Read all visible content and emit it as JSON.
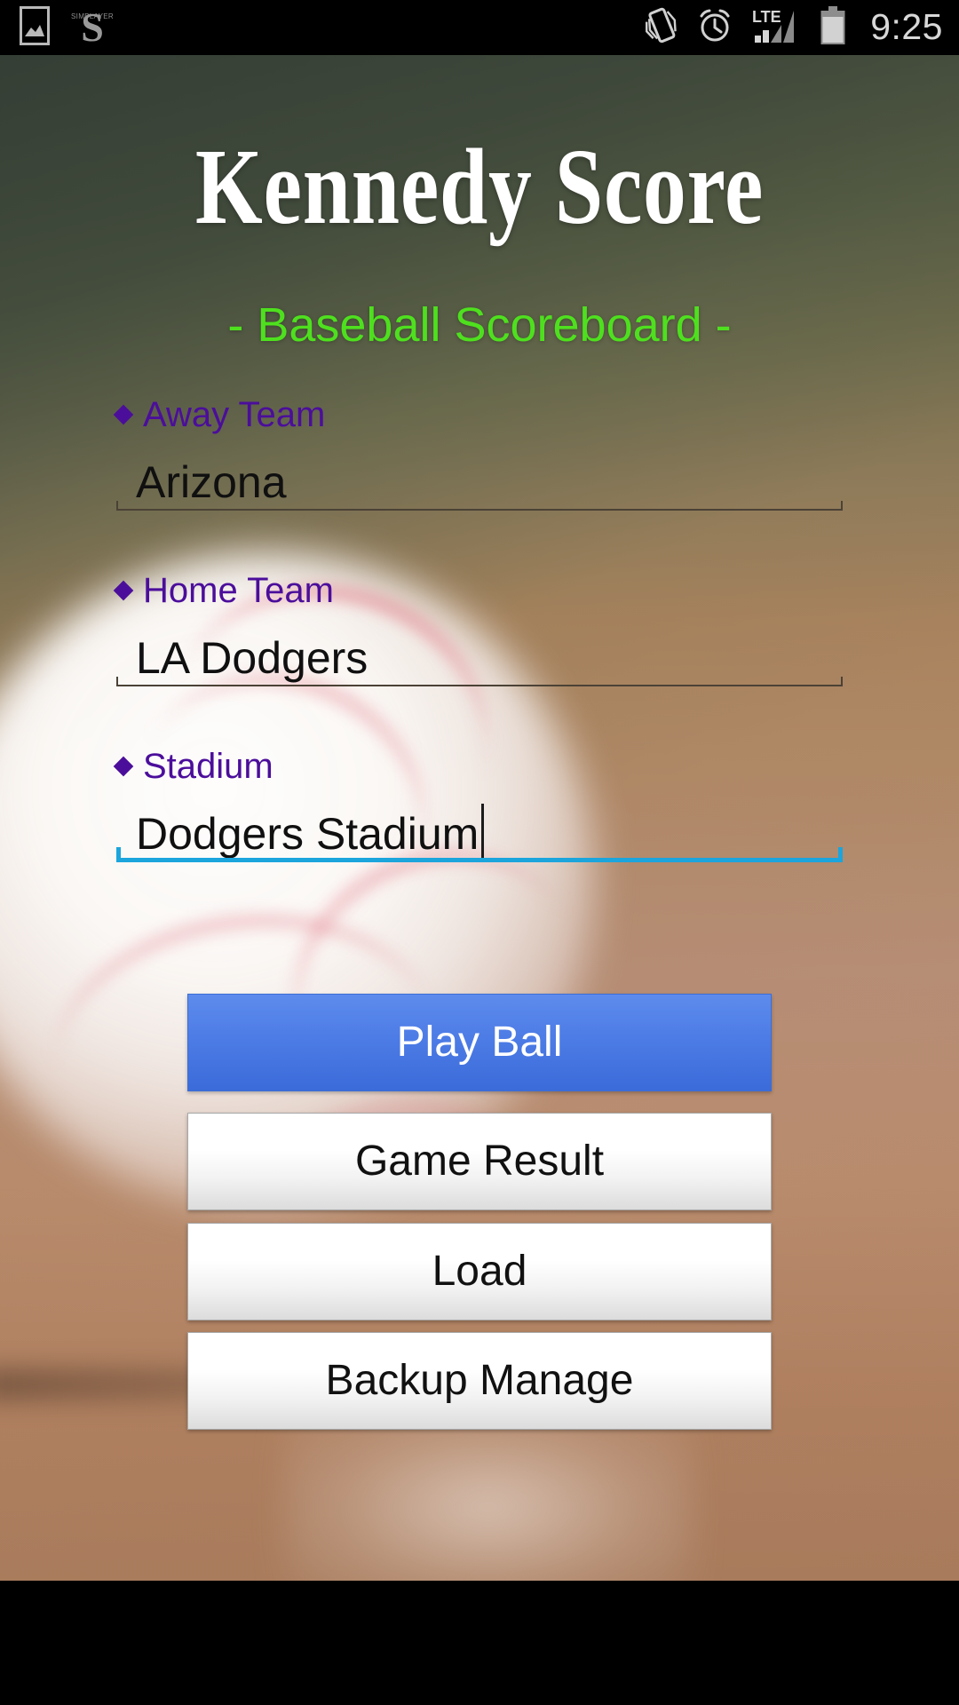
{
  "status_bar": {
    "left_icons": [
      {
        "name": "gallery-image-icon",
        "glyph": "image"
      },
      {
        "name": "simplayer-logo-icon",
        "glyph": "S",
        "word": "SIMPLAYER"
      }
    ],
    "right_icons": [
      {
        "name": "vibrate-icon"
      },
      {
        "name": "alarm-clock-icon"
      },
      {
        "name": "lte-signal-icon",
        "label": "LTE",
        "bars_filled": 2,
        "bars_total": 4
      },
      {
        "name": "battery-icon",
        "level_percent": 85
      }
    ],
    "clock": "9:25"
  },
  "header": {
    "title": "Kennedy Score",
    "subtitle": "- Baseball Scoreboard -",
    "title_color": "#ffffff",
    "subtitle_color": "#4ee01e"
  },
  "form": {
    "label_color": "#4b0e9b",
    "focus_color": "#1ba5dc",
    "fields": [
      {
        "name": "away-team",
        "label": "Away Team",
        "value": "Arizona",
        "placeholder": "Away Team",
        "focused": false
      },
      {
        "name": "home-team",
        "label": "Home Team",
        "value": "LA Dodgers",
        "placeholder": "Home Team",
        "focused": false
      },
      {
        "name": "stadium",
        "label": "Stadium",
        "value": "Dodgers Stadium",
        "placeholder": "Stadium",
        "focused": true
      }
    ]
  },
  "buttons": {
    "primary_color": "#4d7ce6",
    "items": [
      {
        "name": "play-ball-button",
        "label": "Play Ball",
        "style": "primary"
      },
      {
        "name": "game-result-button",
        "label": "Game Result",
        "style": "secondary"
      },
      {
        "name": "load-button",
        "label": "Load",
        "style": "secondary"
      },
      {
        "name": "backup-manage-button",
        "label": "Backup Manage",
        "style": "secondary"
      }
    ]
  }
}
